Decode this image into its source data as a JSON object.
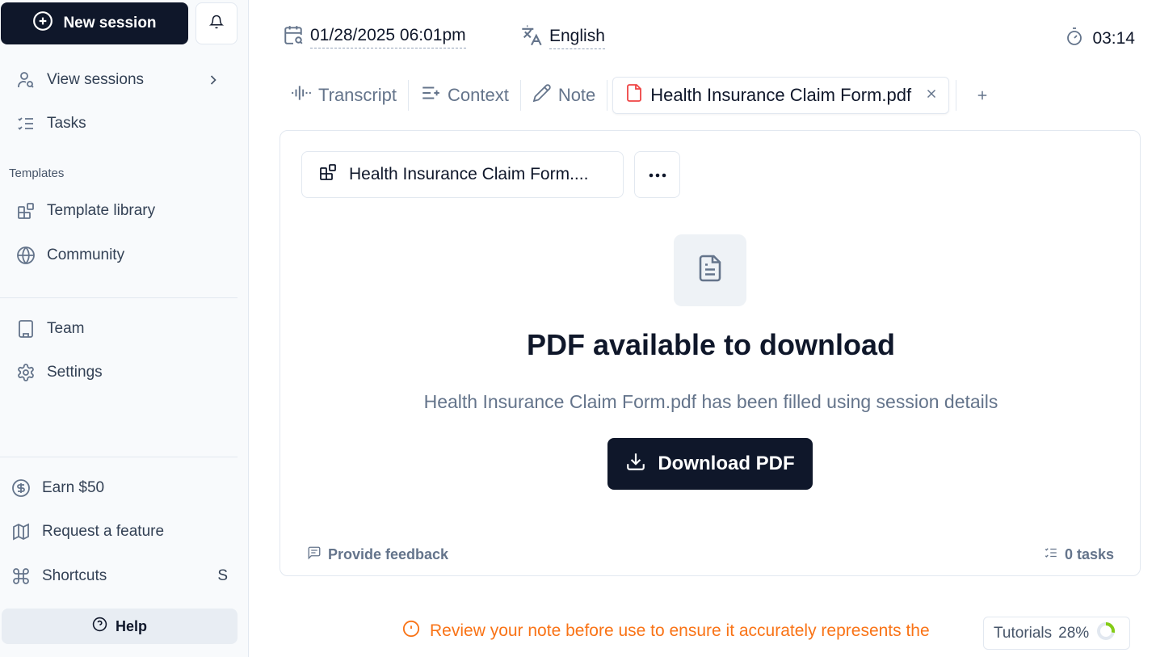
{
  "sidebar": {
    "new_session_label": "New session",
    "items": [
      {
        "label": "View sessions",
        "icon": "user-search-icon"
      },
      {
        "label": "Tasks",
        "icon": "list-checks-icon"
      }
    ],
    "templates_section_label": "Templates",
    "template_items": [
      {
        "label": "Template library",
        "icon": "blocks-icon"
      },
      {
        "label": "Community",
        "icon": "globe-icon"
      }
    ],
    "org_items": [
      {
        "label": "Team",
        "icon": "building-icon"
      },
      {
        "label": "Settings",
        "icon": "gear-icon"
      }
    ],
    "footer_items": [
      {
        "label": "Earn $50",
        "icon": "dollar-circle-icon"
      },
      {
        "label": "Request a feature",
        "icon": "map-icon"
      },
      {
        "label": "Shortcuts",
        "icon": "command-icon",
        "shortcut": "S"
      }
    ],
    "help_label": "Help"
  },
  "header": {
    "datetime": "01/28/2025 06:01pm",
    "language": "English",
    "timer": "03:14"
  },
  "tabs": [
    {
      "label": "Transcript",
      "icon": "audio-waveform-icon"
    },
    {
      "label": "Context",
      "icon": "text-plus-icon"
    },
    {
      "label": "Note",
      "icon": "pencil-icon"
    },
    {
      "label": "Health Insurance Claim Form.pdf",
      "icon": "pdf-file-icon",
      "active": true
    }
  ],
  "panel": {
    "template_name": "Health Insurance Claim Form....",
    "title": "PDF available to download",
    "subtitle": "Health Insurance Claim Form.pdf has been filled using session details",
    "download_label": "Download PDF",
    "feedback_label": "Provide feedback",
    "tasks_label": "0 tasks"
  },
  "warning_text": "Review your note before use to ensure it accurately represents the",
  "tutorials": {
    "label": "Tutorials",
    "percent_text": "28%",
    "progress": 0.28
  },
  "colors": {
    "primary": "#0f172a",
    "warning": "#f97316",
    "pdf_red": "#ef4444",
    "progress_green": "#84cc16"
  }
}
